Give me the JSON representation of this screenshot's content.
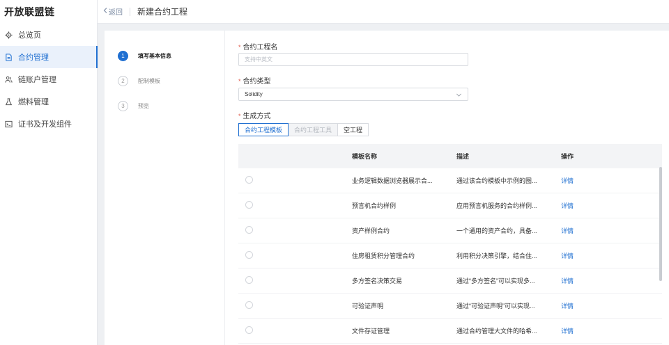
{
  "sidebar": {
    "title": "开放联盟链",
    "items": [
      {
        "label": "总览页",
        "icon": "gear-icon"
      },
      {
        "label": "合约管理",
        "icon": "document-icon",
        "active": true
      },
      {
        "label": "链账户管理",
        "icon": "users-icon"
      },
      {
        "label": "燃料管理",
        "icon": "flask-icon"
      },
      {
        "label": "证书及开发组件",
        "icon": "terminal-icon"
      }
    ]
  },
  "topbar": {
    "back_label": "返回",
    "title": "新建合约工程"
  },
  "steps": [
    {
      "num": "1",
      "label": "填写基本信息",
      "active": true
    },
    {
      "num": "2",
      "label": "配制模板"
    },
    {
      "num": "3",
      "label": "预览"
    }
  ],
  "form": {
    "name_label": "合约工程名",
    "name_placeholder": "支持中英文",
    "type_label": "合约类型",
    "type_value": "Solidity",
    "method_label": "生成方式",
    "methods": [
      "合约工程模板",
      "合约工程工具",
      "空工程"
    ]
  },
  "table": {
    "headers": {
      "name": "模板名称",
      "desc": "描述",
      "op": "操作"
    },
    "rows": [
      {
        "name": "业务逻辑数据浏览器展示合...",
        "desc": "通过该合约模板中示例的图...",
        "op": "详情"
      },
      {
        "name": "预言机合约样例",
        "desc": "应用预言机服务的合约样例...",
        "op": "详情"
      },
      {
        "name": "资产样例合约",
        "desc": "一个通用的资产合约，具备...",
        "op": "详情"
      },
      {
        "name": "住房租赁积分管理合约",
        "desc": "利用积分决策引擎，结合住...",
        "op": "详情"
      },
      {
        "name": "多方签名决策交易",
        "desc": "通过“多方签名”可以实现多...",
        "op": "详情"
      },
      {
        "name": "可验证声明",
        "desc": "通过“可验证声明”可以实现...",
        "op": "详情"
      },
      {
        "name": "文件存证管理",
        "desc": "通过合约管理大文件的哈希...",
        "op": "详情"
      }
    ]
  },
  "colors": {
    "accent": "#1f6fd1",
    "required": "#e05a4a"
  }
}
